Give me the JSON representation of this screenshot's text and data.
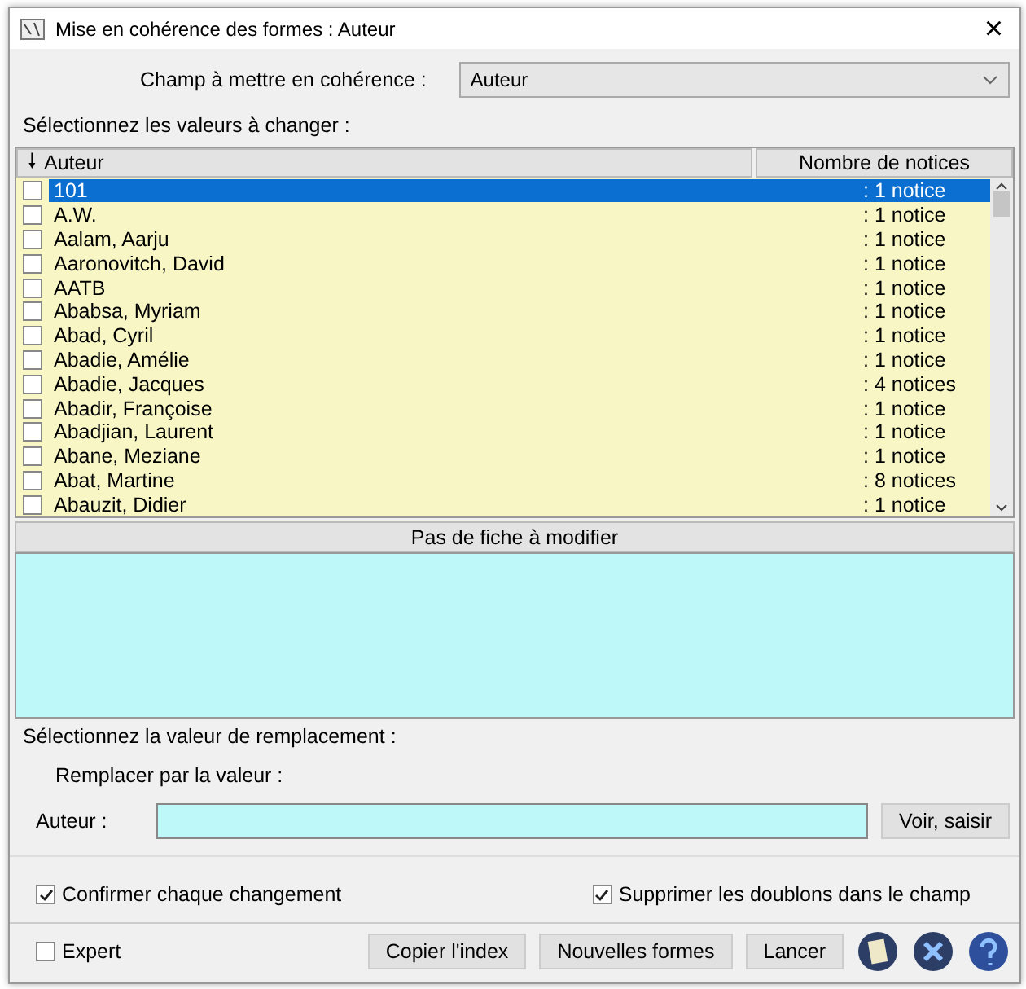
{
  "window": {
    "title": "Mise en cohérence des formes :  Auteur",
    "close": "×"
  },
  "field_select": {
    "label": "Champ à mettre en cohérence :",
    "value": "Auteur"
  },
  "values_group": {
    "title": "Sélectionnez les valeurs à changer :"
  },
  "table": {
    "columns": [
      {
        "label": "Auteur",
        "sort_icon": "🠗"
      },
      {
        "label": "Nombre de notices"
      }
    ],
    "rows": [
      {
        "name": "101",
        "count": ": 1 notice",
        "checked": false,
        "selected": true
      },
      {
        "name": "A.W.",
        "count": ": 1 notice",
        "checked": false,
        "selected": false
      },
      {
        "name": "Aalam, Aarju",
        "count": ": 1 notice",
        "checked": false,
        "selected": false
      },
      {
        "name": "Aaronovitch, David",
        "count": ": 1 notice",
        "checked": false,
        "selected": false
      },
      {
        "name": "AATB",
        "count": ": 1 notice",
        "checked": false,
        "selected": false
      },
      {
        "name": "Ababsa, Myriam",
        "count": ": 1 notice",
        "checked": false,
        "selected": false
      },
      {
        "name": "Abad, Cyril",
        "count": ": 1 notice",
        "checked": false,
        "selected": false
      },
      {
        "name": "Abadie, Amélie",
        "count": ": 1 notice",
        "checked": false,
        "selected": false
      },
      {
        "name": "Abadie, Jacques",
        "count": ": 4 notices",
        "checked": false,
        "selected": false
      },
      {
        "name": "Abadir, Françoise",
        "count": ": 1 notice",
        "checked": false,
        "selected": false
      },
      {
        "name": "Abadjian, Laurent",
        "count": ": 1 notice",
        "checked": false,
        "selected": false
      },
      {
        "name": "Abane, Meziane",
        "count": ": 1 notice",
        "checked": false,
        "selected": false
      },
      {
        "name": "Abat, Martine",
        "count": ": 8 notices",
        "checked": false,
        "selected": false
      },
      {
        "name": "Abauzit, Didier",
        "count": ": 1 notice",
        "checked": false,
        "selected": false
      }
    ]
  },
  "records_panel": {
    "title": "Pas de fiche à modifier"
  },
  "replacement_group": {
    "title": "Sélectionnez la valeur de remplacement :",
    "subtitle": "Remplacer par la valeur :",
    "field_label": "Auteur  :",
    "value_button": "Voir, saisir"
  },
  "options": [
    {
      "label": "Confirmer chaque changement",
      "checked": true
    },
    {
      "label": "Supprimer les doublons dans le champ",
      "checked": true
    }
  ],
  "footer": {
    "expert": {
      "label": "Expert",
      "checked": false
    },
    "buttons": [
      "Copier l'index",
      "Nouvelles formes",
      "Lancer"
    ]
  }
}
